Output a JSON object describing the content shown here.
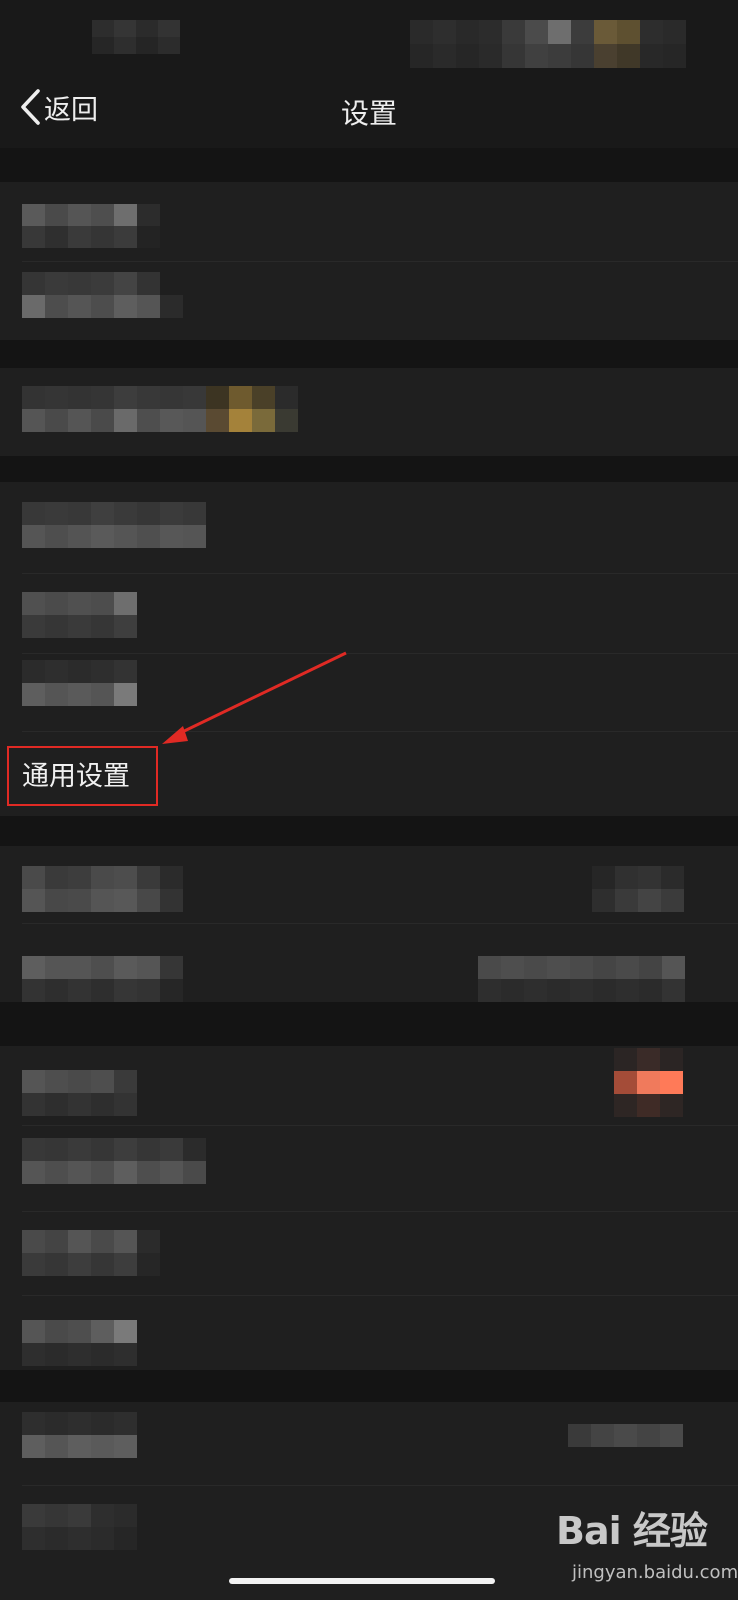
{
  "nav": {
    "back_label": "返回",
    "title": "设置"
  },
  "list": {
    "general_settings_label": "通用设置"
  },
  "icons": {
    "back": "chevron-left-icon"
  },
  "colors": {
    "annotation": "#e02a24",
    "background": "#1d1d1d",
    "row": "#1f1f1f"
  },
  "watermark": {
    "logo": "Bai 经验",
    "site": "jingyan.baidu.com"
  }
}
